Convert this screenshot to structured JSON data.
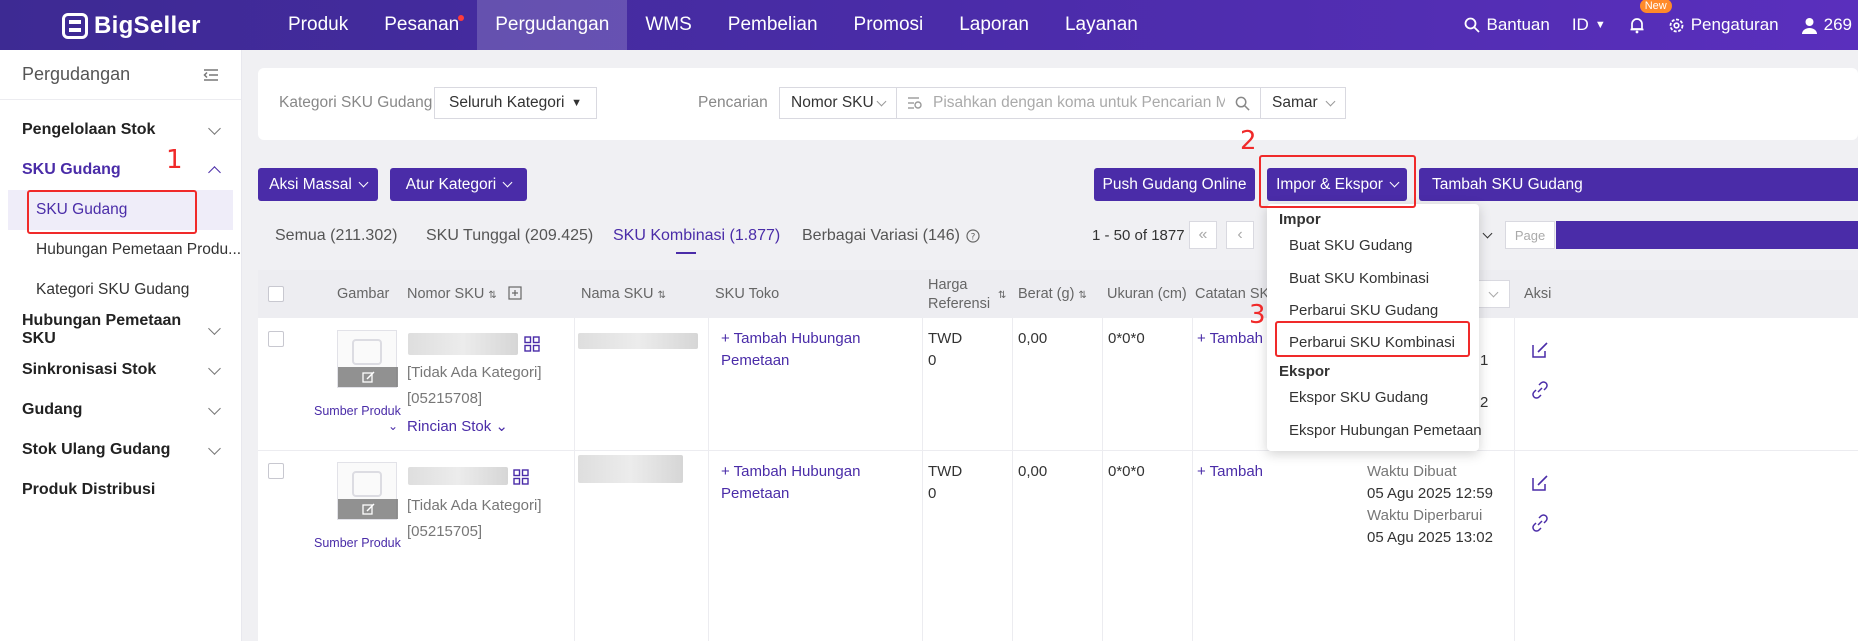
{
  "brand": {
    "name": "BigSeller"
  },
  "nav": {
    "items": [
      {
        "label": "Produk"
      },
      {
        "label": "Pesanan"
      },
      {
        "label": "Pergudangan"
      },
      {
        "label": "WMS"
      },
      {
        "label": "Pembelian"
      },
      {
        "label": "Promosi"
      },
      {
        "label": "Laporan"
      },
      {
        "label": "Layanan"
      }
    ],
    "help": "Bantuan",
    "lang": "ID",
    "new_badge": "New",
    "settings": "Pengaturan",
    "user": "269"
  },
  "sidebar": {
    "title": "Pergudangan",
    "groups": [
      {
        "label": "Pengelolaan Stok"
      },
      {
        "label": "SKU Gudang"
      },
      {
        "label": "Hubungan Pemetaan SKU"
      },
      {
        "label": "Sinkronisasi Stok"
      },
      {
        "label": "Gudang"
      },
      {
        "label": "Stok Ulang Gudang"
      },
      {
        "label": "Produk Distribusi"
      }
    ],
    "subitems": [
      {
        "label": "SKU Gudang"
      },
      {
        "label": "Hubungan Pemetaan Produ..."
      },
      {
        "label": "Kategori SKU Gudang"
      }
    ]
  },
  "filter": {
    "category_label": "Kategori SKU Gudang",
    "category_value": "Seluruh Kategori",
    "search_label": "Pencarian",
    "search_field": "Nomor SKU",
    "search_placeholder": "Pisahkan dengan koma untuk Pencarian Mas...",
    "match_mode": "Samar"
  },
  "toolbar": {
    "bulk": "Aksi Massal",
    "set_category": "Atur Kategori",
    "push": "Push Gudang Online",
    "import_export": "Impor & Ekspor",
    "add": "Tambah SKU Gudang"
  },
  "tabs": {
    "all": "Semua (211.302)",
    "single": "SKU Tunggal (209.425)",
    "combo": "SKU Kombinasi (1.877)",
    "variants": "Berbagai Variasi (146)"
  },
  "pagination": {
    "range": "1 - 50 of 1877",
    "page_placeholder": "Page"
  },
  "table": {
    "headers": {
      "image": "Gambar",
      "sku_no": "Nomor SKU",
      "sku_name": "Nama SKU",
      "shop_sku": "SKU Toko",
      "ref_price": "Harga Referensi",
      "weight": "Berat (g)",
      "size": "Ukuran (cm)",
      "note": "Catatan SKU",
      "action": "Aksi"
    },
    "rows": [
      {
        "source": "Sumber Produk",
        "category": "[Tidak Ada Kategori]",
        "code": "[05215708]",
        "stock_detail": "Rincian Stok",
        "mapping": "+ Tambah Hubungan Pemetaan",
        "currency": "TWD",
        "price": "0",
        "weight": "0,00",
        "size": "0*0*0",
        "note_add": "+ Tambah",
        "side1": "1",
        "side2": "2"
      },
      {
        "source": "Sumber Produk",
        "category": "[Tidak Ada Kategori]",
        "code": "[05215705]",
        "mapping": "+ Tambah Hubungan Pemetaan",
        "currency": "TWD",
        "price": "0",
        "weight": "0,00",
        "size": "0*0*0",
        "note_add": "+ Tambah",
        "created_label": "Waktu Dibuat",
        "created": "05 Agu 2025 12:59",
        "updated_label": "Waktu Diperbarui",
        "updated": "05 Agu 2025 13:02"
      }
    ]
  },
  "dropdown": {
    "import_head": "Impor",
    "import_items": [
      "Buat SKU Gudang",
      "Buat SKU Kombinasi",
      "Perbarui SKU Gudang",
      "Perbarui SKU Kombinasi"
    ],
    "export_head": "Ekspor",
    "export_items": [
      "Ekspor SKU Gudang",
      "Ekspor Hubungan Pemetaan"
    ]
  },
  "annotations": {
    "n1": "1",
    "n2": "2",
    "n3": "3"
  },
  "colors": {
    "primary": "#4a2ca8",
    "annotation": "#f02a2a",
    "badge": "#ff8a2a"
  }
}
